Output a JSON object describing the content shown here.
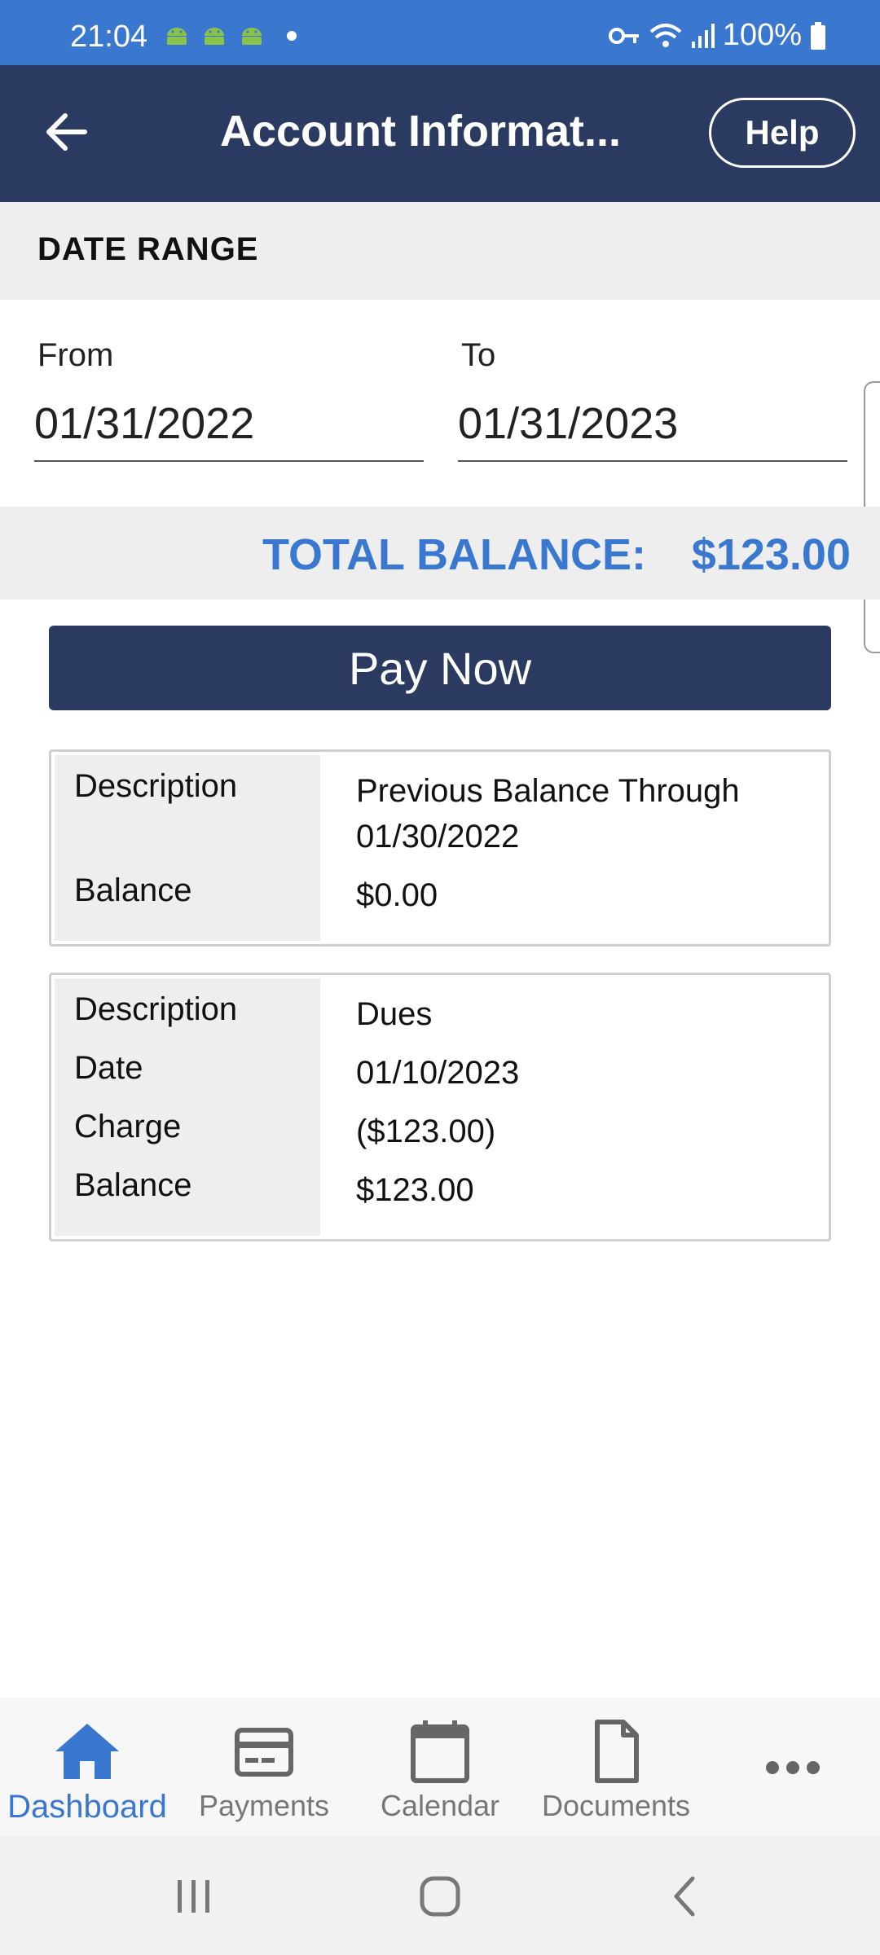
{
  "status_bar": {
    "time": "21:04",
    "battery": "100%",
    "icons": [
      "android-icon",
      "android-icon",
      "android-icon",
      "dot-icon",
      "vpn-key-icon",
      "wifi-icon",
      "signal-icon",
      "battery-icon"
    ]
  },
  "header": {
    "title": "Account Informat...",
    "help_label": "Help"
  },
  "date_range": {
    "section_label": "DATE RANGE",
    "from_label": "From",
    "from_value": "01/31/2022",
    "to_label": "To",
    "to_value": "01/31/2023"
  },
  "total": {
    "label": "TOTAL BALANCE:",
    "value": "$123.00"
  },
  "pay_now_label": "Pay Now",
  "cards": [
    {
      "description_label": "Description",
      "description_value_line1": "Previous Balance Through",
      "description_value_line2": "01/30/2022",
      "balance_label": "Balance",
      "balance_value": "$0.00"
    },
    {
      "description_label": "Description",
      "description_value": "Dues",
      "date_label": "Date",
      "date_value": "01/10/2023",
      "charge_label": "Charge",
      "charge_value": "($123.00)",
      "balance_label": "Balance",
      "balance_value": "$123.00"
    }
  ],
  "bottom_nav": {
    "items": [
      {
        "label": "Dashboard",
        "icon": "home-icon",
        "active": true
      },
      {
        "label": "Payments",
        "icon": "credit-card-icon",
        "active": false
      },
      {
        "label": "Calendar",
        "icon": "calendar-icon",
        "active": false
      },
      {
        "label": "Documents",
        "icon": "document-icon",
        "active": false
      },
      {
        "label": "",
        "icon": "more-icon",
        "active": false
      }
    ]
  },
  "colors": {
    "status_bar": "#3a78cf",
    "header": "#2b3a60",
    "accent": "#3a78cf",
    "section_bg": "#eeeeee"
  }
}
